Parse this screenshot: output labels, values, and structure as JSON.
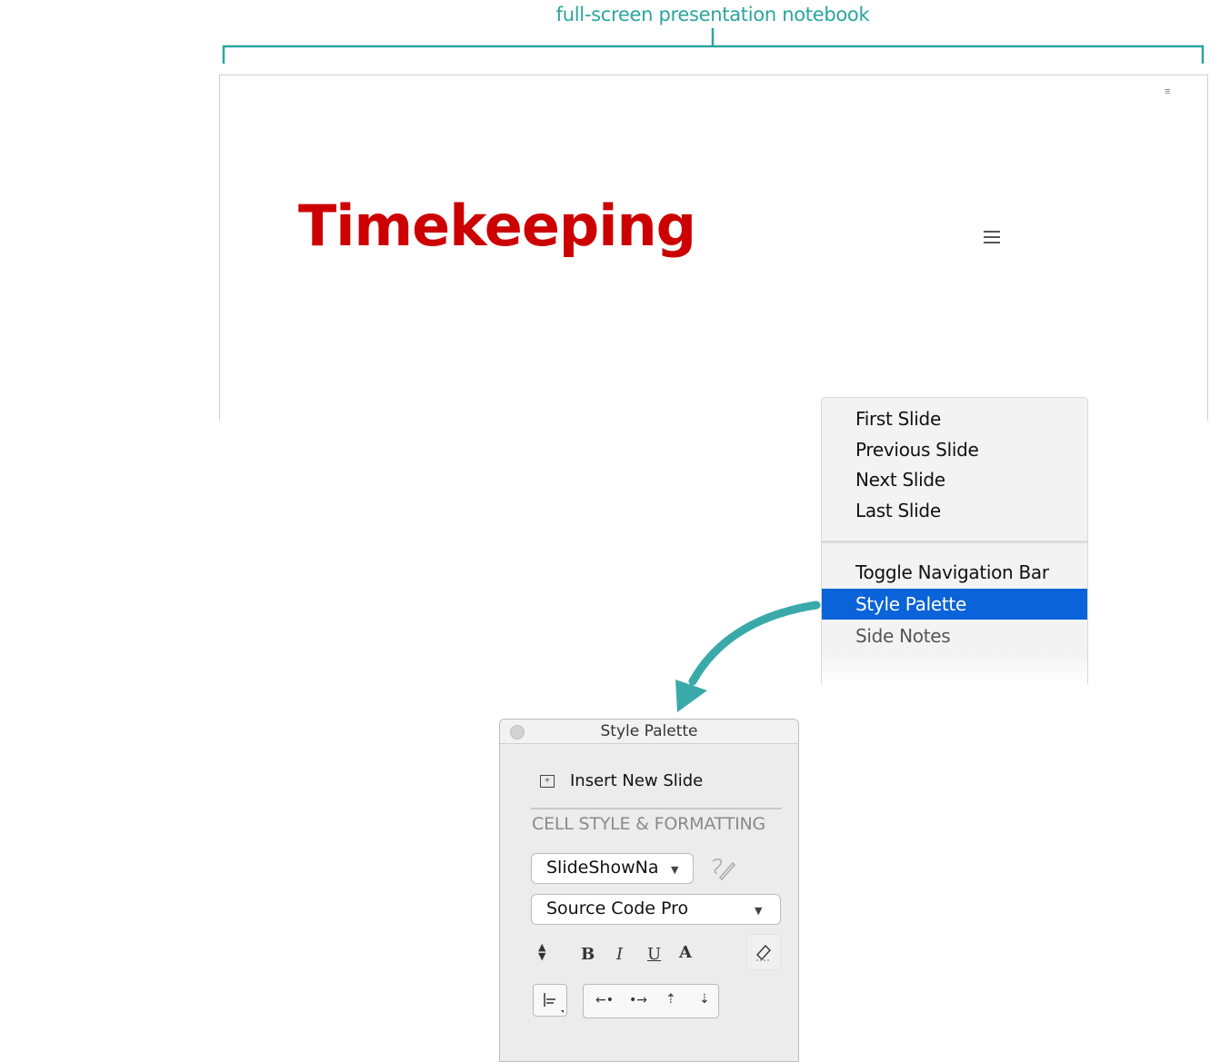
{
  "caption": "full-screen presentation notebook",
  "slide": {
    "title": "Timekeeping"
  },
  "context_menu": {
    "group1": [
      "First Slide",
      "Previous Slide",
      "Next Slide",
      "Last Slide"
    ],
    "group2": [
      "Toggle Navigation Bar",
      "Style Palette",
      "Side Notes"
    ],
    "selected": "Style Palette"
  },
  "palette": {
    "title": "Style Palette",
    "insert_label": "Insert New Slide",
    "section_heading": "CELL STYLE & FORMATTING",
    "style_select": "SlideShowNa",
    "font_select": "Source Code Pro",
    "format_buttons": {
      "bold": "B",
      "italic": "I",
      "underline": "U",
      "color": "A"
    }
  },
  "colors": {
    "annotation": "#2aa59e",
    "title": "#cc0000",
    "selection": "#0a63d8"
  },
  "icons": [
    "menu-icon",
    "insert-slide-icon",
    "style-edit-icon",
    "eraser-icon",
    "align-icon",
    "arrow-left-icon",
    "arrow-right-icon",
    "arrow-up-icon",
    "arrow-down-icon"
  ]
}
